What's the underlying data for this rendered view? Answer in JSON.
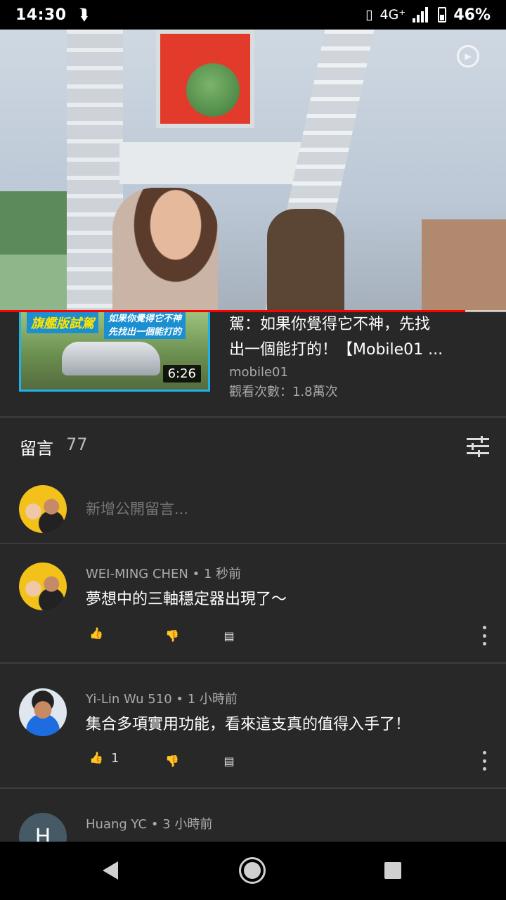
{
  "status_bar": {
    "time": "14:30",
    "notification_icon": "download-arrow-icon",
    "network": "4G⁺",
    "battery_percent": "46%",
    "battery_level": 0.46
  },
  "video": {
    "progress_fraction": 0.92,
    "timer_icon": "timer-play-icon"
  },
  "suggested_video": {
    "thumb_text_left": "旗艦版試駕",
    "thumb_text_right_line1": "如果你覺得它不神",
    "thumb_text_right_line2": "先找出一個能打的",
    "duration": "6:26",
    "title_line1": "駕：如果你覺得它不神，先找",
    "title_line2": "出一個能打的！【Mobile01 ...",
    "channel": "mobile01",
    "views": "觀看次數：1.8萬次"
  },
  "comments_section": {
    "label": "留言",
    "count": "77",
    "filter_icon": "sort-filter-icon",
    "add_placeholder": "新增公開留言..."
  },
  "comments": [
    {
      "author": "WEI-MING CHEN",
      "time": "1 秒前",
      "text": "夢想中的三軸穩定器出現了～",
      "likes": ""
    },
    {
      "author": "Yi-Lin Wu 510",
      "time": "1 小時前",
      "text": "集合多項實用功能，看來這支真的值得入手了！",
      "likes": "1"
    },
    {
      "author": "Huang YC",
      "time": "3 小時前",
      "avatar_letter": "H"
    }
  ],
  "nav_bar": {
    "back_icon": "back-triangle-icon",
    "home_icon": "home-circle-icon",
    "recent_icon": "recent-apps-icon"
  }
}
